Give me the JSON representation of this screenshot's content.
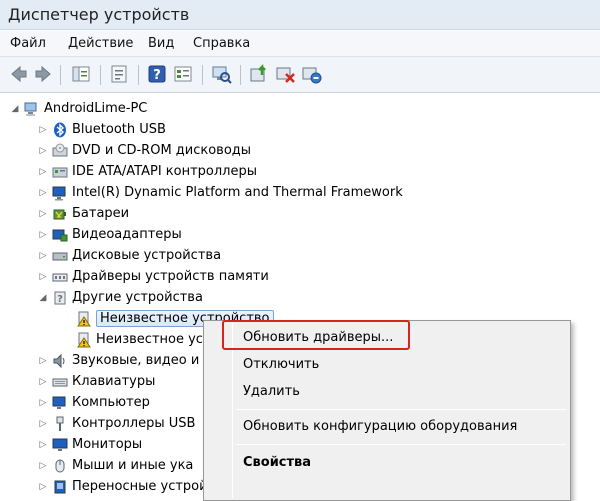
{
  "window": {
    "title": "Диспетчер устройств"
  },
  "menu": [
    "Файл",
    "Действие",
    "Вид",
    "Справка"
  ],
  "toolbar": {
    "icons": [
      "back-arrow-icon",
      "forward-arrow-icon",
      "show-hide-tree-icon",
      "properties-icon",
      "help-icon",
      "view-icon",
      "scan-hardware-icon",
      "update-driver-icon",
      "disable-device-icon",
      "uninstall-device-icon"
    ]
  },
  "tree": {
    "root": "AndroidLime-PC",
    "items": [
      {
        "label": "Bluetooth USB",
        "icon": "bluetooth-icon"
      },
      {
        "label": "DVD и CD-ROM дисководы",
        "icon": "dvd-drive-icon"
      },
      {
        "label": "IDE ATA/ATAPI контроллеры",
        "icon": "ide-controller-icon"
      },
      {
        "label": "Intel(R) Dynamic Platform and Thermal Framework",
        "icon": "computer-monitor-icon"
      },
      {
        "label": "Батареи",
        "icon": "battery-icon"
      },
      {
        "label": "Видеоадаптеры",
        "icon": "display-adapter-icon"
      },
      {
        "label": "Дисковые устройства",
        "icon": "disk-drive-icon"
      },
      {
        "label": "Драйверы устройств памяти",
        "icon": "memory-device-icon"
      },
      {
        "label": "Другие устройства",
        "icon": "other-devices-icon"
      },
      {
        "label": "Неизвестное устройство",
        "icon": "warning-unknown-device-icon"
      },
      {
        "label": "Неизвестное ус",
        "icon": "warning-unknown-device-icon"
      },
      {
        "label": "Звуковые, видео и",
        "icon": "sound-icon"
      },
      {
        "label": "Клавиатуры",
        "icon": "keyboard-icon"
      },
      {
        "label": "Компьютер",
        "icon": "computer-icon"
      },
      {
        "label": "Контроллеры USB",
        "icon": "usb-controller-icon"
      },
      {
        "label": "Мониторы",
        "icon": "monitor-icon"
      },
      {
        "label": "Мыши и иные ука",
        "icon": "mouse-icon"
      },
      {
        "label": "Переносные устройства",
        "icon": "portable-device-icon"
      }
    ]
  },
  "context_menu": {
    "items": [
      "Обновить драйверы...",
      "Отключить",
      "Удалить",
      "Обновить конфигурацию оборудования",
      "Свойства"
    ]
  }
}
